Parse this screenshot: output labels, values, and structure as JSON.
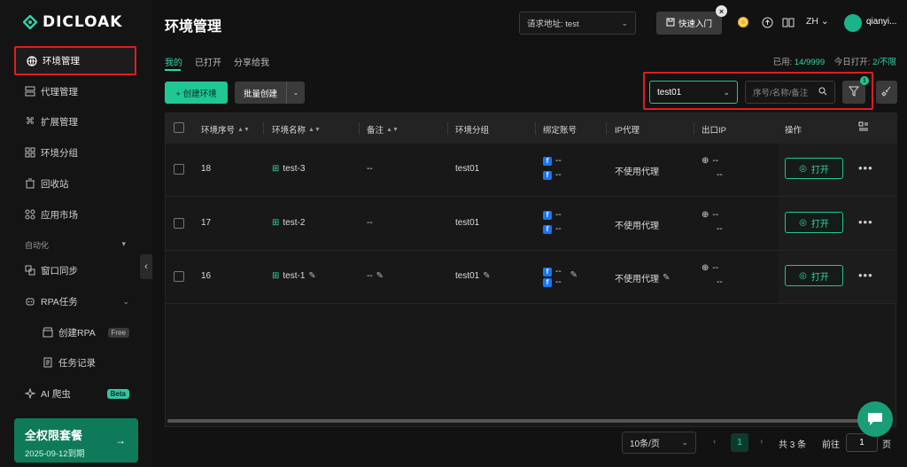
{
  "brand": {
    "name": "DICLOAK"
  },
  "sidebar": {
    "items": [
      {
        "label": "环境管理",
        "icon": "globe-icon"
      },
      {
        "label": "代理管理",
        "icon": "proxy-icon"
      },
      {
        "label": "扩展管理",
        "icon": "extension-icon"
      },
      {
        "label": "环境分组",
        "icon": "group-icon"
      },
      {
        "label": "回收站",
        "icon": "trash-icon"
      },
      {
        "label": "应用市场",
        "icon": "apps-icon"
      }
    ],
    "section_label": "自动化",
    "automation": [
      {
        "label": "窗口同步",
        "icon": "sync-icon"
      },
      {
        "label": "RPA任务",
        "icon": "rpa-icon"
      },
      {
        "label": "创建RPA",
        "badge": "Free",
        "icon": "store-icon"
      },
      {
        "label": "任务记录",
        "icon": "doc-icon"
      },
      {
        "label": "AI 爬虫",
        "badge": "Beta",
        "icon": "ai-icon"
      }
    ],
    "plan": {
      "title": "全权限套餐",
      "expiry": "2025-09-12到期"
    }
  },
  "header": {
    "title": "环境管理",
    "url_input": "请求地址: test",
    "quick_entry": "快速入门",
    "quick_close": "×",
    "lang": "ZH",
    "user": "qianyi..."
  },
  "tabs": [
    "我的",
    "已打开",
    "分享给我"
  ],
  "usage": {
    "used_label": "已用: ",
    "used_value": "14/9999",
    "today_label": "今日打开: ",
    "today_value": "2/不限"
  },
  "toolbar": {
    "create": "+ 创建环境",
    "batch": "批量创建",
    "group_select": "test01",
    "search_placeholder": "序号/名称/备注",
    "filter_count": "1"
  },
  "table": {
    "columns": [
      "环境序号",
      "环境名称",
      "备注",
      "环境分组",
      "绑定账号",
      "IP代理",
      "出口IP",
      "操作"
    ],
    "rows": [
      {
        "id": "18",
        "name": "test-3",
        "note": "--",
        "group": "test01",
        "acc1": "--",
        "acc2": "--",
        "proxy": "不使用代理",
        "ip1": "--",
        "ip2": "--",
        "action": "打开",
        "editable": false
      },
      {
        "id": "17",
        "name": "test-2",
        "note": "--",
        "group": "test01",
        "acc1": "--",
        "acc2": "--",
        "proxy": "不使用代理",
        "ip1": "--",
        "ip2": "--",
        "action": "打开",
        "editable": false
      },
      {
        "id": "16",
        "name": "test-1",
        "note": "--",
        "group": "test01",
        "acc1": "--",
        "acc2": "--",
        "proxy": "不使用代理",
        "ip1": "--",
        "ip2": "--",
        "action": "打开",
        "editable": true
      }
    ]
  },
  "pagination": {
    "page_size": "10条/页",
    "current": "1",
    "total": "共 3 条",
    "goto_label": "前往",
    "goto_value": "1",
    "page_suffix": "页"
  },
  "colors": {
    "accent": "#1fc795",
    "highlight": "#e01e1e"
  }
}
